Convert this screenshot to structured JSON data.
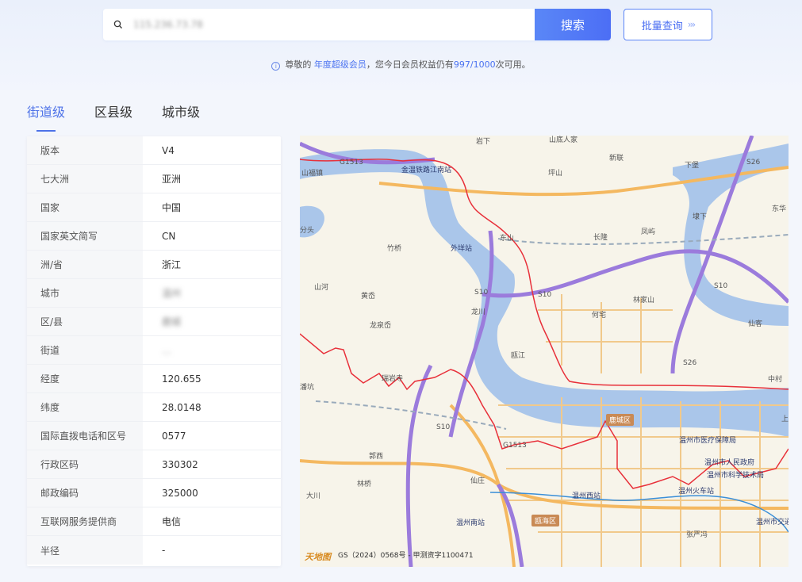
{
  "search": {
    "value": "115.236.73.78",
    "button": "搜索",
    "batch_label": "批量查询",
    "batch_arrows": "›››"
  },
  "notice": {
    "info": "i",
    "prefix": "尊敬的",
    "level": "年度超级会员",
    "middle": "，您今日会员权益仍有",
    "quota": "997/1000",
    "suffix": "次可用。"
  },
  "tabs": [
    "街道级",
    "区县级",
    "城市级"
  ],
  "rows": [
    {
      "key": "版本",
      "value": "V4"
    },
    {
      "key": "七大洲",
      "value": "亚洲"
    },
    {
      "key": "国家",
      "value": "中国"
    },
    {
      "key": "国家英文简写",
      "value": "CN"
    },
    {
      "key": "洲/省",
      "value": "浙江"
    },
    {
      "key": "城市",
      "value": "温州"
    },
    {
      "key": "区/县",
      "value": "鹿城"
    },
    {
      "key": "街道",
      "value": "…"
    },
    {
      "key": "经度",
      "value": "120.655"
    },
    {
      "key": "纬度",
      "value": "28.0148"
    },
    {
      "key": "国际直拨电话和区号",
      "value": "0577"
    },
    {
      "key": "行政区码",
      "value": "330302"
    },
    {
      "key": "邮政编码",
      "value": "325000"
    },
    {
      "key": "互联网服务提供商",
      "value": "电信"
    },
    {
      "key": "半径",
      "value": "-"
    }
  ],
  "map": {
    "labels": {
      "l1": "岩下",
      "l2": "山底人家",
      "l3": "坪山",
      "l4": "新联",
      "l5": "下堡",
      "l6": "山福镇",
      "l7": "金温铁路江南站",
      "l8": "竹桥",
      "l9": "外垟站",
      "l10": "东山",
      "l11": "长隆",
      "l12": "凤屿",
      "l13": "埭下",
      "l14": "东华",
      "l15": "分头",
      "l16": "山河",
      "l17": "黄岙",
      "l18": "龙川",
      "l19": "林家山",
      "l20": "龙泉岙",
      "l21": "何宅",
      "l22": "仙客",
      "l23": "中村",
      "l24": "瑞岩寺",
      "l25": "潘坑",
      "l26": "郭西",
      "l27": "林桥",
      "l28": "大川",
      "l29": "仙庄",
      "l30": "温州南站",
      "l31": "温州西站",
      "l32": "温州火车站",
      "l33": "张严冯",
      "l34": "温州市医疗保障局",
      "l35": "温州市人民政府",
      "l36": "温州市科学技术局",
      "l37": "温州市交通",
      "l38": "瓯江",
      "l39": "上"
    },
    "district_lucheng": "鹿城区",
    "district_ouhai": "瓯海区",
    "roads": {
      "g1513a": "G1513",
      "g1513b": "G1513",
      "s26a": "S26",
      "s26b": "S26",
      "s10a": "S10",
      "s10b": "S10",
      "s10c": "S10",
      "s10d": "S10"
    },
    "copyright": "GS（2024）0568号 - 甲测资字1100471",
    "logo": "天地图"
  }
}
